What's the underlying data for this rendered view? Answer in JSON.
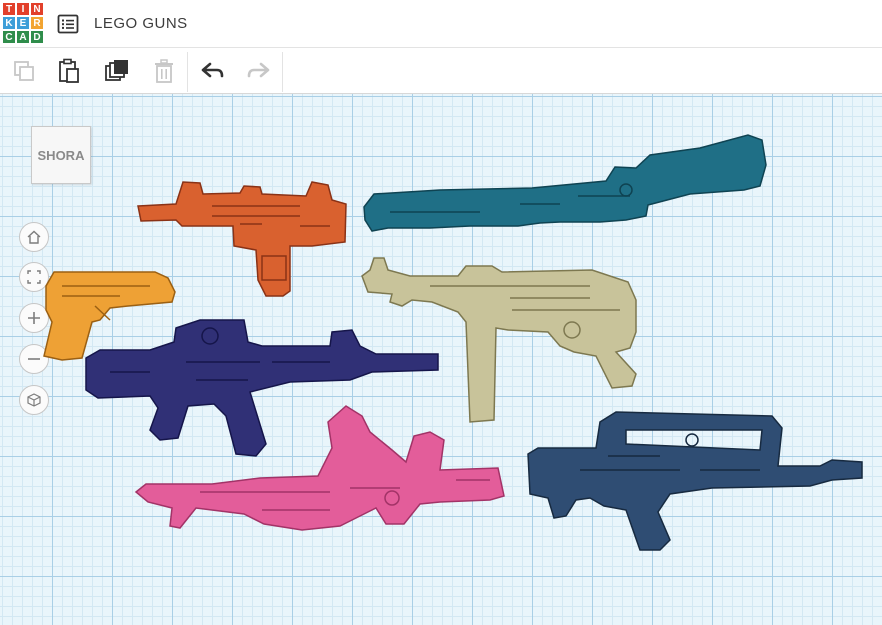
{
  "app": {
    "logo_letters": [
      "T",
      "I",
      "N",
      "K",
      "E",
      "R",
      "C",
      "A",
      "D"
    ],
    "logo_colors": [
      "#e2402b",
      "#e2402b",
      "#e2402b",
      "#3d9ed8",
      "#3d9ed8",
      "#f2a431",
      "#2f8d4b",
      "#2f8d4b",
      "#2f8d4b"
    ],
    "project_title": "LEGO GUNS"
  },
  "toolbar": {
    "items": [
      {
        "name": "copy-icon",
        "enabled": false
      },
      {
        "name": "paste-icon",
        "enabled": true
      },
      {
        "name": "duplicate-icon",
        "enabled": true
      },
      {
        "name": "delete-icon",
        "enabled": false
      },
      {
        "name": "undo-icon",
        "enabled": true
      },
      {
        "name": "redo-icon",
        "enabled": false
      }
    ]
  },
  "viewcube": {
    "label": "SHORA"
  },
  "nav_controls": [
    "home-icon",
    "fit-view-icon",
    "zoom-in-icon",
    "zoom-out-icon",
    "perspective-icon"
  ],
  "shapes": [
    {
      "name": "uzi",
      "color": "#d9612f"
    },
    {
      "name": "rifle",
      "color": "#1f6f86"
    },
    {
      "name": "pistol",
      "color": "#eea135"
    },
    {
      "name": "smg-mp40",
      "color": "#c8c39a"
    },
    {
      "name": "assault-rifle",
      "color": "#303076"
    },
    {
      "name": "bullpup-rifle",
      "color": "#e35d9a"
    },
    {
      "name": "famas",
      "color": "#2f4d73"
    }
  ]
}
